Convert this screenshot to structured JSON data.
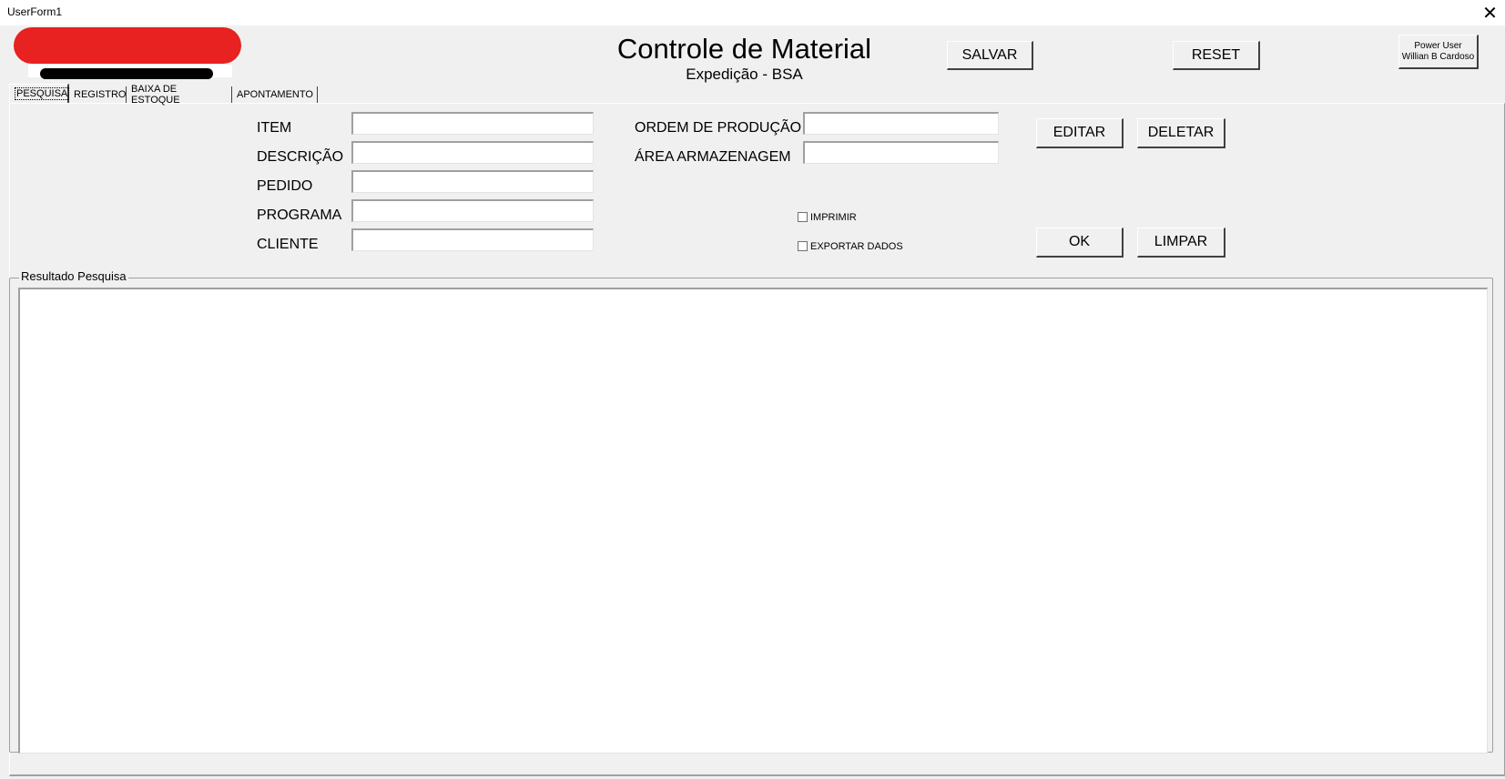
{
  "window": {
    "title": "UserForm1",
    "close_icon": "close-icon"
  },
  "header": {
    "title": "Controle de Material",
    "subtitle": "Expedição - BSA",
    "save_label": "SALVAR",
    "reset_label": "RESET",
    "user_label": "Power User Willian B Cardoso",
    "logo_color": "#e82121"
  },
  "tabs": [
    {
      "label": "PESQUISA",
      "active": true
    },
    {
      "label": "REGISTRO",
      "active": false
    },
    {
      "label": "BAIXA DE ESTOQUE",
      "active": false
    },
    {
      "label": "APONTAMENTO",
      "active": false
    }
  ],
  "search": {
    "fields_left": [
      {
        "label": "ITEM",
        "value": ""
      },
      {
        "label": "DESCRIÇÃO",
        "value": ""
      },
      {
        "label": "PEDIDO",
        "value": ""
      },
      {
        "label": "PROGRAMA",
        "value": ""
      },
      {
        "label": "CLIENTE",
        "value": ""
      }
    ],
    "fields_right": [
      {
        "label": "ORDEM DE PRODUÇÃO",
        "value": ""
      },
      {
        "label": "ÁREA ARMAZENAGEM",
        "value": ""
      }
    ],
    "checkboxes": [
      {
        "label": "IMPRIMIR",
        "checked": false
      },
      {
        "label": "EXPORTAR DADOS",
        "checked": false
      }
    ],
    "edit_label": "EDITAR",
    "delete_label": "DELETAR",
    "ok_label": "OK",
    "clear_label": "LIMPAR"
  },
  "results": {
    "caption": "Resultado Pesquisa",
    "rows": []
  }
}
